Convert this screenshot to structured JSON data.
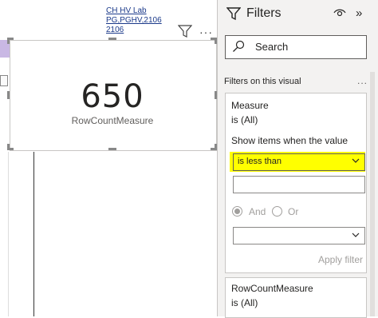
{
  "visual_header": {
    "title_lines": [
      "CH HV Lab",
      "PG,PGHV,2106",
      "2106"
    ],
    "more_label": "···"
  },
  "card_visual": {
    "value": "650",
    "label": "RowCountMeasure"
  },
  "filters_pane": {
    "title": "Filters",
    "search_placeholder": "Search",
    "section_label": "Filters on this visual",
    "more_label": "...",
    "collapse_glyph": "»",
    "filter_cards": [
      {
        "field": "Measure",
        "state": "is (All)",
        "show_items_label": "Show items when the value",
        "condition1": "is less than",
        "condition1_value": "",
        "and_label": "And",
        "or_label": "Or",
        "condition2": "",
        "apply_label": "Apply filter"
      },
      {
        "field": "RowCountMeasure",
        "state": "is (All)"
      }
    ]
  },
  "colors": {
    "highlight": "#ffff00",
    "pane_bg": "#f3f2f1",
    "link": "#1b3a8a",
    "disabled_text": "#a19f9d",
    "canvas_strip": "#c9b8e4"
  },
  "icons": [
    "filter-icon",
    "more-icon",
    "funnel-icon",
    "eye-icon",
    "collapse-icon",
    "search-icon",
    "chevron-down-icon"
  ]
}
